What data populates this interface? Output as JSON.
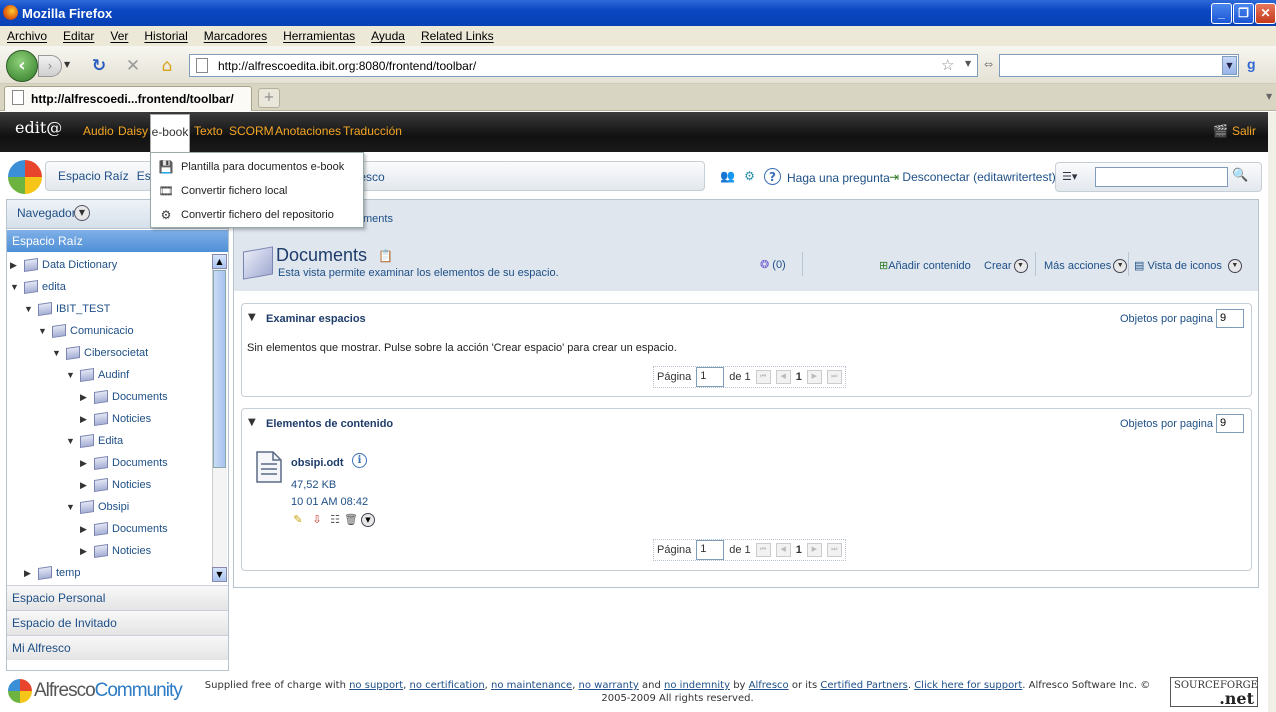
{
  "window": {
    "title": "Mozilla Firefox",
    "buttons": [
      "_",
      "❐",
      "✕"
    ]
  },
  "menubar": [
    "Archivo",
    "Editar",
    "Ver",
    "Historial",
    "Marcadores",
    "Herramientas",
    "Ayuda",
    "Related Links"
  ],
  "address": {
    "url": "http://alfrescoedita.ibit.org:8080/frontend/toolbar/"
  },
  "tabs": [
    {
      "label": "http://alfrescoedi...frontend/toolbar/"
    }
  ],
  "app_toolbar": {
    "logo": "edit@",
    "items": [
      "Audio",
      "Daisy",
      "e-book",
      "Texto",
      "SCORM",
      "Anotaciones",
      "Traducción"
    ],
    "active": "e-book",
    "salir": "Salir"
  },
  "ebook_menu": [
    "Plantilla para documentos e-book",
    "Convertir fichero local",
    "Convertir fichero del repositorio"
  ],
  "header": {
    "breadcrumb_left": "Espacio Raíz",
    "breadcrumb_left2": "Espa",
    "breadcrumb_right": "fresco",
    "help": "Haga una pregunta",
    "logout": "Desconectar (editawritertest)"
  },
  "navigator": {
    "title": "Navegador",
    "active_space": "Espacio Raíz",
    "tree": [
      {
        "label": "Data Dictionary",
        "depth": 0,
        "arrow": "▶"
      },
      {
        "label": "edita",
        "depth": 0,
        "arrow": "▼"
      },
      {
        "label": "IBIT_TEST",
        "depth": 1,
        "arrow": "▼"
      },
      {
        "label": "Comunicacio",
        "depth": 2,
        "arrow": "▼"
      },
      {
        "label": "Cibersocietat",
        "depth": 3,
        "arrow": "▼"
      },
      {
        "label": "Audinf",
        "depth": 4,
        "arrow": "▼"
      },
      {
        "label": "Documents",
        "depth": 5,
        "arrow": "▶"
      },
      {
        "label": "Noticies",
        "depth": 5,
        "arrow": "▶"
      },
      {
        "label": "Edita",
        "depth": 4,
        "arrow": "▼"
      },
      {
        "label": "Documents",
        "depth": 5,
        "arrow": "▶"
      },
      {
        "label": "Noticies",
        "depth": 5,
        "arrow": "▶"
      },
      {
        "label": "Obsipi",
        "depth": 4,
        "arrow": "▼"
      },
      {
        "label": "Documents",
        "depth": 5,
        "arrow": "▶"
      },
      {
        "label": "Noticies",
        "depth": 5,
        "arrow": "▶"
      },
      {
        "label": "temp",
        "depth": 1,
        "arrow": "▶"
      }
    ],
    "accordion": [
      "Espacio Personal",
      "Espacio de Invitado",
      "Mi Alfresco"
    ]
  },
  "main": {
    "breadcrumb": "ments",
    "title": "Documents",
    "subtitle": "Esta vista permite examinar los elementos de su espacio.",
    "rss_count": "(0)",
    "actions": {
      "add": "Añadir contenido",
      "create": "Crear",
      "more": "Más acciones",
      "view": "Vista de iconos"
    },
    "spaces": {
      "title": "Examinar espacios",
      "per_page_label": "Objetos por pagina",
      "per_page": "9",
      "empty": "Sin elementos que mostrar. Pulse sobre la acción 'Crear espacio' para crear un espacio."
    },
    "content": {
      "title": "Elementos de contenido",
      "per_page_label": "Objetos por pagina",
      "per_page": "9",
      "file": {
        "name": "obsipi.odt",
        "size": "47,52 KB",
        "date": "10 01 AM 08:42"
      }
    },
    "pager": {
      "label": "Página",
      "page": "1",
      "of": "de 1",
      "current": "1"
    }
  },
  "footer": {
    "brand_a": "Alfresco",
    "brand_b": "Community",
    "pre": "Supplied free of charge with",
    "links": [
      "no support",
      "no certification",
      "no maintenance",
      "no warranty",
      "no indemnity",
      "Alfresco",
      "Certified Partners",
      "Click here for support"
    ],
    "and": "and",
    "by": "by",
    "or_its": "or its",
    "copyright": "Alfresco Software Inc. © 2005-2009 All rights reserved.",
    "sourceforge_top": "SOURCEFORGE",
    "sourceforge_net": ".net"
  }
}
